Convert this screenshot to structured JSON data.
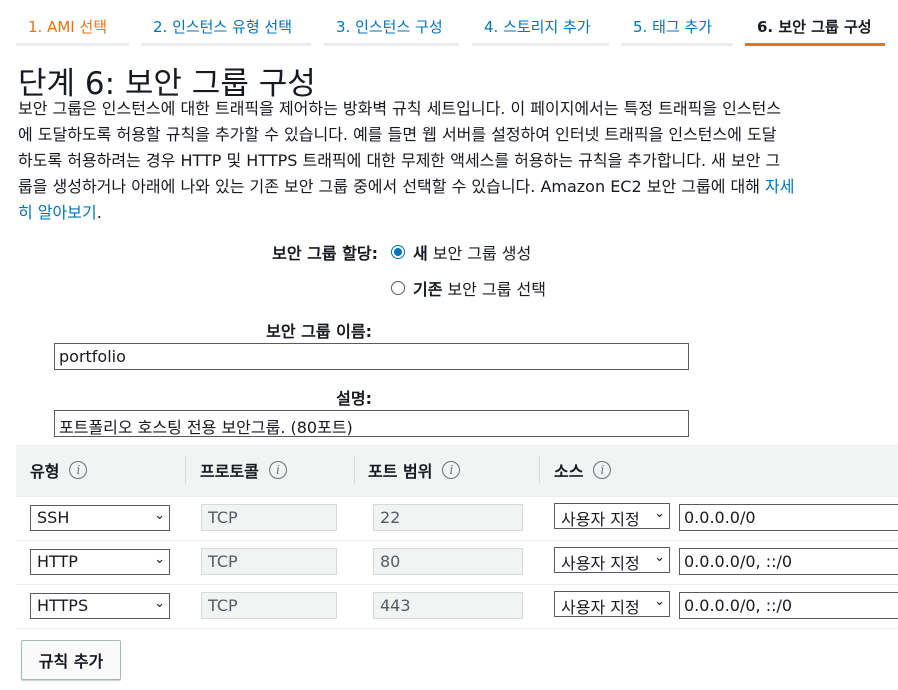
{
  "steps": [
    {
      "label": "1. AMI 선택"
    },
    {
      "label": "2. 인스턴스 유형 선택"
    },
    {
      "label": "3. 인스턴스 구성"
    },
    {
      "label": "4. 스토리지 추가"
    },
    {
      "label": "5. 태그 추가"
    },
    {
      "label": "6. 보안 그룹 구성"
    }
  ],
  "page": {
    "title": "단계 6: 보안 그룹 구성",
    "desc_lines": [
      "보안 그룹은 인스턴스에 대한 트래픽을 제어하는 방화벽 규칙 세트입니다. 이 페이지에서는 특정 트래픽을 인스턴스",
      "에 도달하도록 허용할 규칙을 추가할 수 있습니다. 예를 들면 웹 서버를 설정하여 인터넷 트래픽을 인스턴스에 도달",
      "하도록 허용하려는 경우 HTTP 및 HTTPS 트래픽에 대한 무제한 액세스를 허용하는 규칙을 추가합니다. 새 보안 그",
      "룹을 생성하거나 아래에 나와 있는 기존 보안 그룹 중에서 선택할 수 있습니다. Amazon EC2 보안 그룹에 대해 "
    ],
    "link_part1": "자세",
    "link_part2": "히 알아보기",
    "link_suffix": "."
  },
  "assign": {
    "label": "보안 그룹 할당:",
    "new_bold": "새",
    "new_rest": "보안 그룹 생성",
    "existing_bold": "기존",
    "existing_rest": "보안 그룹 선택",
    "selected": "new"
  },
  "name_field": {
    "label": "보안 그룹 이름:",
    "value": "portfolio"
  },
  "desc_field": {
    "label": "설명:",
    "value": "포트폴리오 호스팅 전용 보안그룹. (80포트)"
  },
  "table": {
    "headers": {
      "type": "유형",
      "protocol": "프로토콜",
      "port": "포트 범위",
      "source": "소스"
    },
    "rows": [
      {
        "type": "SSH",
        "protocol": "TCP",
        "port": "22",
        "source_type": "사용자 지정",
        "source": "0.0.0.0/0"
      },
      {
        "type": "HTTP",
        "protocol": "TCP",
        "port": "80",
        "source_type": "사용자 지정",
        "source": "0.0.0.0/0, ::/0"
      },
      {
        "type": "HTTPS",
        "protocol": "TCP",
        "port": "443",
        "source_type": "사용자 지정",
        "source": "0.0.0.0/0, ::/0"
      }
    ]
  },
  "add_rule_label": "규칙 추가",
  "icons": {
    "info": "i",
    "chevron": "⌄"
  },
  "colors": {
    "accent": "#ec7211",
    "link": "#0073bb"
  }
}
